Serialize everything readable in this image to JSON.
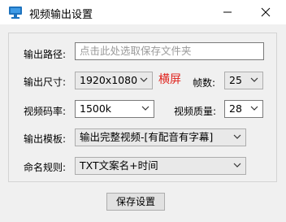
{
  "window": {
    "title": "视频输出设置",
    "icon": "monitor-icon",
    "accent_color": "#1e73be",
    "minimize_icon": "minimize-icon",
    "close_icon": "close-icon"
  },
  "output_path": {
    "label": "输出路径:",
    "placeholder": "点击此处选取保存文件夹"
  },
  "output_size": {
    "label": "输出尺寸:",
    "value": "1920x1080",
    "orientation": "横屏",
    "orientation_color": "#e0221c"
  },
  "fps": {
    "label": "帧数:",
    "value": "25"
  },
  "bitrate": {
    "label": "视频码率:",
    "value": "1500k"
  },
  "quality": {
    "label": "视频质量:",
    "value": "28"
  },
  "template": {
    "label": "输出模板:",
    "value": "输出完整视频-[有配音有字幕]"
  },
  "naming": {
    "label": "命名规则:",
    "value": "TXT文案名+时间"
  },
  "save_button": {
    "label": "保存设置"
  }
}
